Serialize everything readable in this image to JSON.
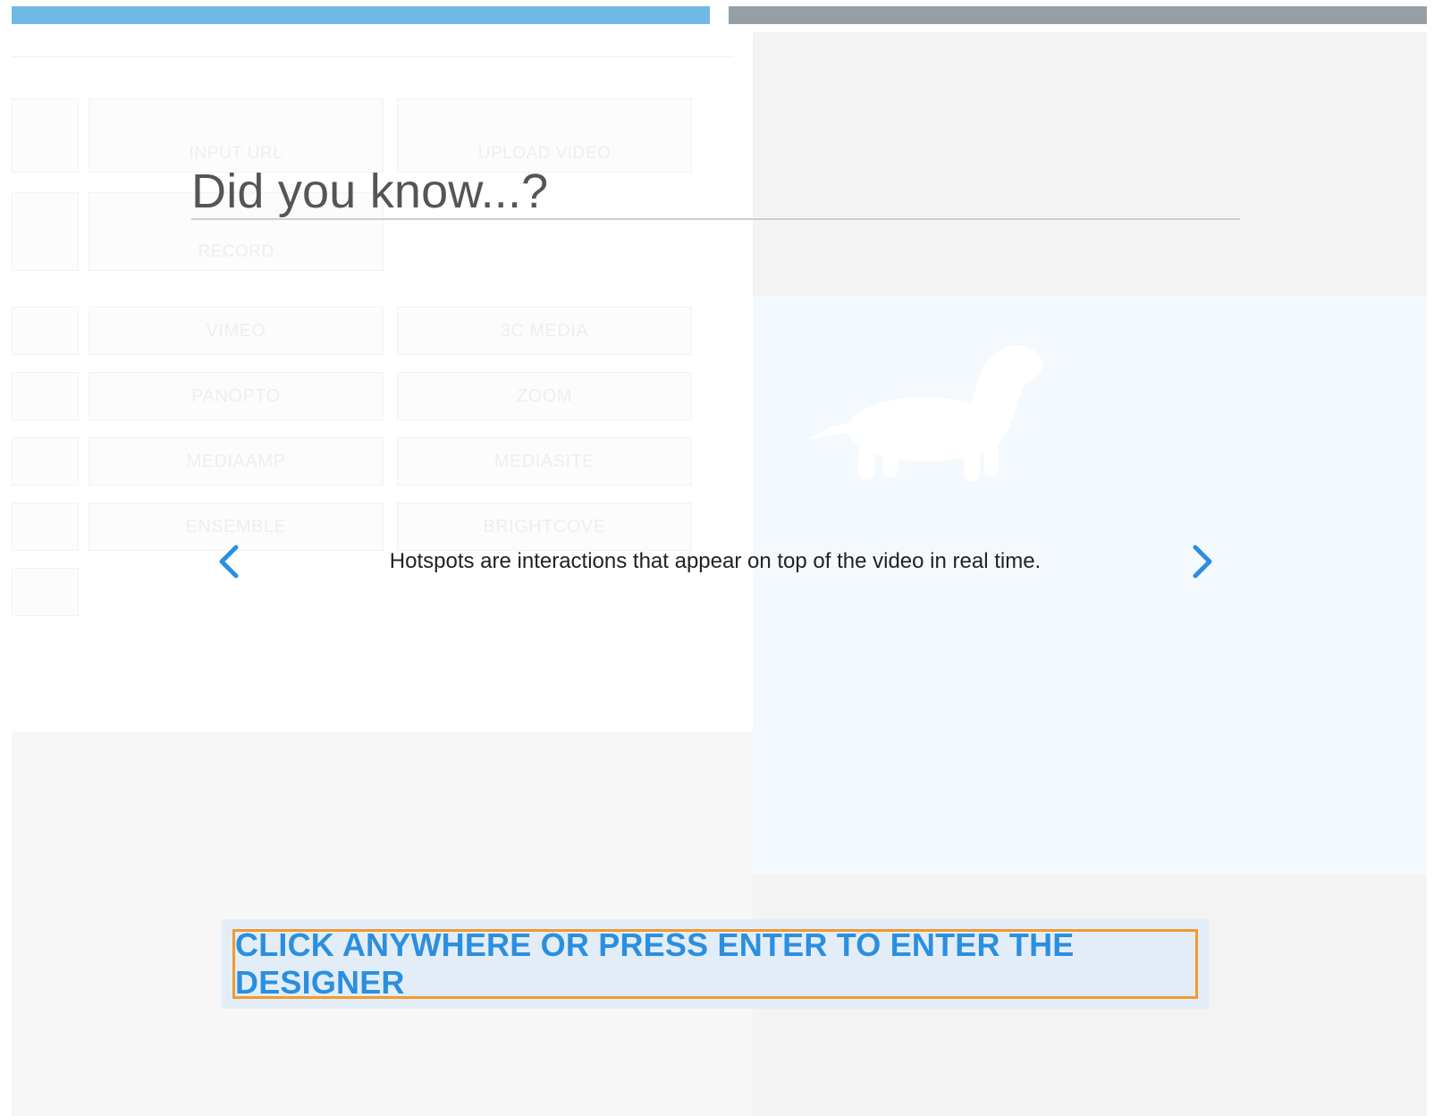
{
  "overlay": {
    "title": "Did you know...?",
    "fact": "Hotspots are interactions that appear on top of the video in real time.",
    "cta_label": "CLICK ANYWHERE OR PRESS ENTER TO ENTER THE DESIGNER"
  },
  "ghost_sources": {
    "input_url": "INPUT URL",
    "upload_video": "UPLOAD VIDEO",
    "record": "RECORD",
    "vimeo": "VIMEO",
    "3c_media": "3C MEDIA",
    "panopto": "PANOPTO",
    "zoom": "ZOOM",
    "mediaamp": "MEDIAAMP",
    "mediasite": "MEDIASITE",
    "ensemble": "ENSEMBLE",
    "brightcove": "BRIGHTCOVE"
  },
  "icons": {
    "prev": "chevron-left-icon",
    "next": "chevron-right-icon",
    "mascot": "dachshund-icon"
  },
  "colors": {
    "progress_active": "#6fb9e7",
    "progress_inactive": "#979fa6",
    "accent_blue": "#2b8fe0",
    "cta_border": "#f29a2e"
  }
}
